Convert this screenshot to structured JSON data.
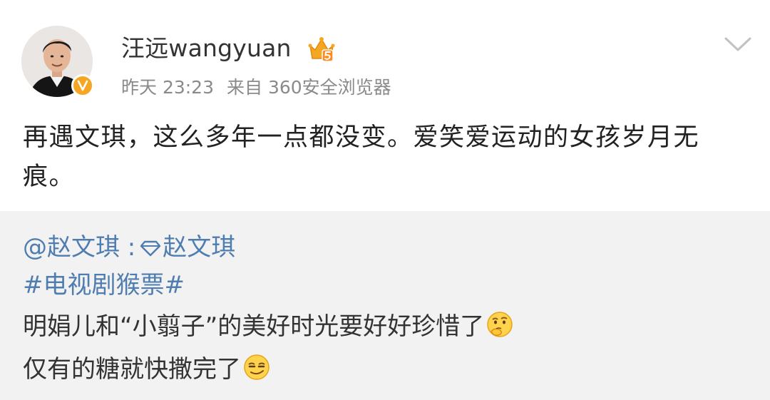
{
  "post": {
    "username": "汪远wangyuan",
    "time": "昨天 23:23",
    "source": "来自 360安全浏览器",
    "text": "再遇文琪，这么多年一点都没变。爱笑爱运动的女孩岁月无痕。",
    "icons": {
      "avatar": "user-avatar",
      "verified": "verified-badge-icon",
      "vip": "crown-vip-badge-icon",
      "menu": "chevron-down-icon"
    },
    "colors": {
      "verified": "#f6a623",
      "vip": "#f5a623"
    }
  },
  "repost": {
    "mention": "@赵文琪",
    "separator": " :",
    "mention2": "赵文琪",
    "topic": "#电视剧猴票#",
    "line3": "明娟儿和“小翦子”的美好时光要好好珍惜了",
    "line4": "仅有的糖就快撒完了",
    "icons": [
      "diamond-icon",
      "thinking-emoji-icon",
      "smirk-emoji-icon"
    ],
    "colors": {
      "link": "#4f7db0",
      "background": "#f2f2f2"
    }
  }
}
